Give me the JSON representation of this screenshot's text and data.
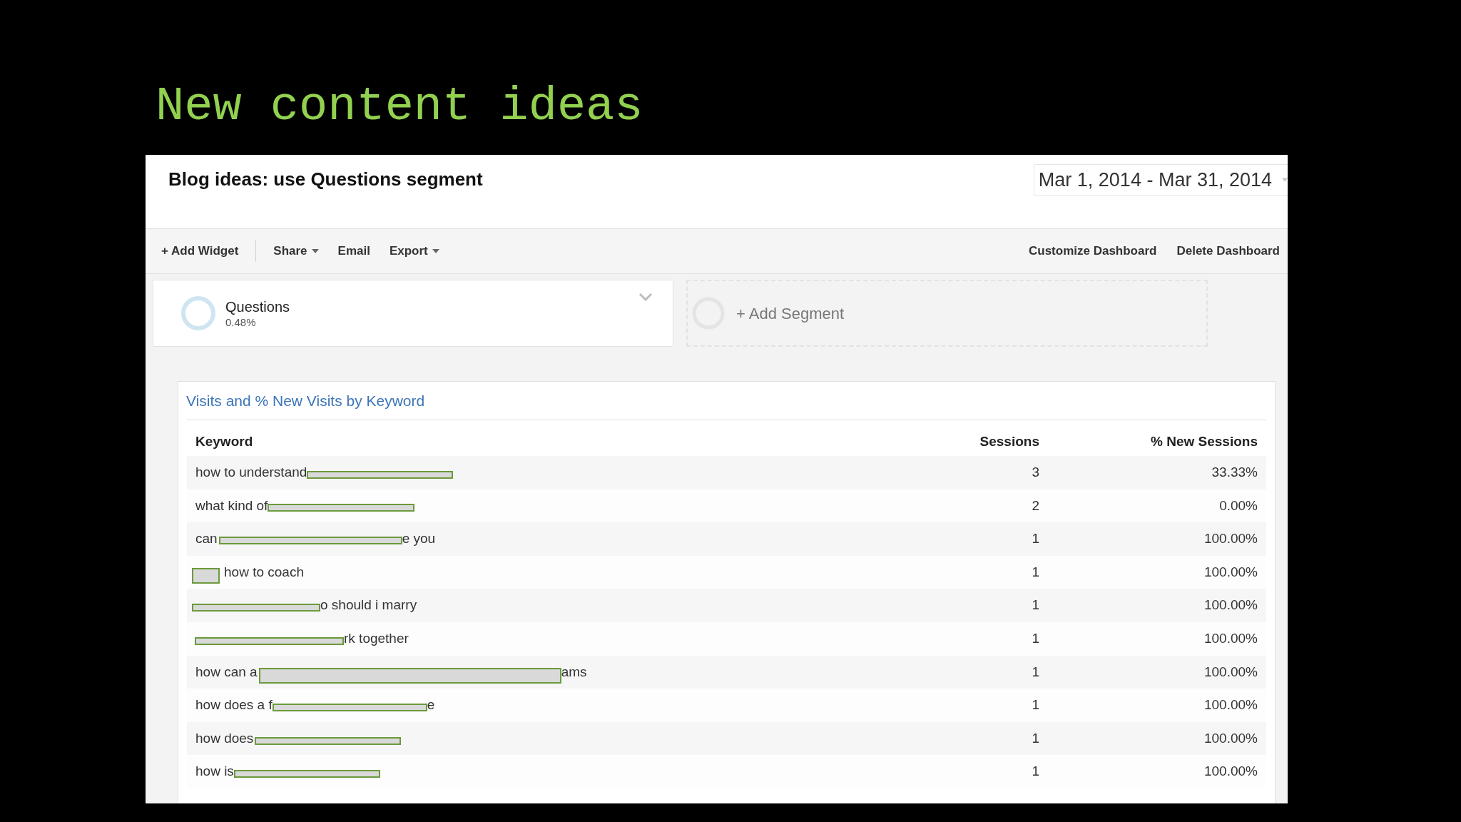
{
  "slide": {
    "title": "New content ideas"
  },
  "dashboard": {
    "title": "Blog ideas: use Questions segment",
    "date_range": "Mar 1, 2014 - Mar 31, 2014",
    "toolbar": {
      "groups": [
        [
          {
            "label": "+ Add Widget",
            "kind": "plain"
          }
        ],
        [
          {
            "label": "Share",
            "kind": "menu"
          },
          {
            "label": "Email",
            "kind": "plain"
          },
          {
            "label": "Export",
            "kind": "menu"
          }
        ]
      ],
      "right": [
        "Customize Dashboard",
        "Delete Dashboard"
      ]
    },
    "segments": [
      {
        "kind": "applied",
        "name": "Questions",
        "share": "0.48%"
      },
      {
        "kind": "add",
        "label": "+ Add Segment"
      }
    ],
    "widget": {
      "title": "Visits and % New Visits by Keyword",
      "table": {
        "columns": [
          "Keyword",
          "Sessions",
          "% New Sessions"
        ],
        "rows": [
          {
            "keyword": [
              {
                "kind": "text",
                "text": "how to understand"
              },
              {
                "kind": "redaction"
              }
            ],
            "sessions": "3",
            "new_sessions": "33.33%"
          },
          {
            "keyword": [
              {
                "kind": "text",
                "text": "what kind of"
              },
              {
                "kind": "redaction"
              }
            ],
            "sessions": "2",
            "new_sessions": "0.00%"
          },
          {
            "keyword": [
              {
                "kind": "text",
                "text": "can"
              },
              {
                "kind": "redaction"
              },
              {
                "kind": "text",
                "text": "e you"
              }
            ],
            "sessions": "1",
            "new_sessions": "100.00%"
          },
          {
            "keyword": [
              {
                "kind": "redaction"
              },
              {
                "kind": "text",
                "text": "how to coach"
              }
            ],
            "sessions": "1",
            "new_sessions": "100.00%"
          },
          {
            "keyword": [
              {
                "kind": "redaction"
              },
              {
                "kind": "text",
                "text": "o should i marry"
              }
            ],
            "sessions": "1",
            "new_sessions": "100.00%"
          },
          {
            "keyword": [
              {
                "kind": "redaction"
              },
              {
                "kind": "text",
                "text": "rk together"
              }
            ],
            "sessions": "1",
            "new_sessions": "100.00%"
          },
          {
            "keyword": [
              {
                "kind": "text",
                "text": "how can a"
              },
              {
                "kind": "redaction"
              },
              {
                "kind": "text",
                "text": "ams"
              }
            ],
            "sessions": "1",
            "new_sessions": "100.00%"
          },
          {
            "keyword": [
              {
                "kind": "text",
                "text": "how does a f"
              },
              {
                "kind": "redaction"
              },
              {
                "kind": "text",
                "text": "e"
              }
            ],
            "sessions": "1",
            "new_sessions": "100.00%"
          },
          {
            "keyword": [
              {
                "kind": "text",
                "text": "how does"
              },
              {
                "kind": "redaction"
              }
            ],
            "sessions": "1",
            "new_sessions": "100.00%"
          },
          {
            "keyword": [
              {
                "kind": "text",
                "text": "how is"
              },
              {
                "kind": "redaction"
              }
            ],
            "sessions": "1",
            "new_sessions": "100.00%"
          }
        ]
      }
    }
  }
}
